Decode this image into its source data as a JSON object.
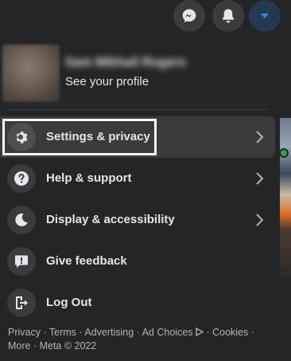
{
  "topbar": {
    "messenger_icon": "messenger-icon",
    "notifications_icon": "bell-icon",
    "account_icon": "caret-down-icon",
    "account_accent": "#2d88ff"
  },
  "profile": {
    "name": "Sam Mikhail Rogers",
    "subtitle": "See your profile"
  },
  "menu": {
    "items": [
      {
        "label": "Settings & privacy",
        "icon": "gear-icon",
        "has_chevron": true
      },
      {
        "label": "Help & support",
        "icon": "question-icon",
        "has_chevron": true
      },
      {
        "label": "Display & accessibility",
        "icon": "moon-icon",
        "has_chevron": true
      },
      {
        "label": "Give feedback",
        "icon": "feedback-icon",
        "has_chevron": false
      },
      {
        "label": "Log Out",
        "icon": "logout-icon",
        "has_chevron": false
      }
    ]
  },
  "footer": {
    "links": [
      "Privacy",
      "Terms",
      "Advertising",
      "Ad Choices",
      "Cookies",
      "More"
    ],
    "copyright": "Meta © 2022",
    "separator": " · "
  }
}
